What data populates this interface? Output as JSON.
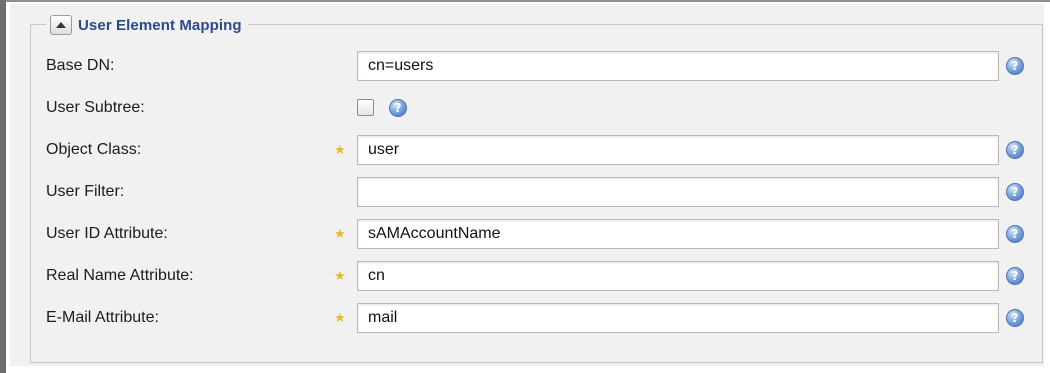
{
  "section": {
    "title": "User Element Mapping",
    "collapse_icon": "triangle-up-icon"
  },
  "rows": [
    {
      "label": "Base DN:",
      "required": false,
      "type": "text",
      "value": "cn=users"
    },
    {
      "label": "User Subtree:",
      "required": false,
      "type": "checkbox",
      "checked": false
    },
    {
      "label": "Object Class:",
      "required": true,
      "type": "text",
      "value": "user"
    },
    {
      "label": "User Filter:",
      "required": false,
      "type": "text",
      "value": ""
    },
    {
      "label": "User ID Attribute:",
      "required": true,
      "type": "text",
      "value": "sAMAccountName"
    },
    {
      "label": "Real Name Attribute:",
      "required": true,
      "type": "text",
      "value": "cn"
    },
    {
      "label": "E-Mail Attribute:",
      "required": true,
      "type": "text",
      "value": "mail"
    }
  ],
  "icons": {
    "help": "help-icon",
    "help_glyph": "?",
    "required": "required-star-icon",
    "required_glyph": "★"
  },
  "colors": {
    "title": "#2a4a8c",
    "required_star": "#e8b825",
    "help_icon": "#3e6fb7"
  }
}
